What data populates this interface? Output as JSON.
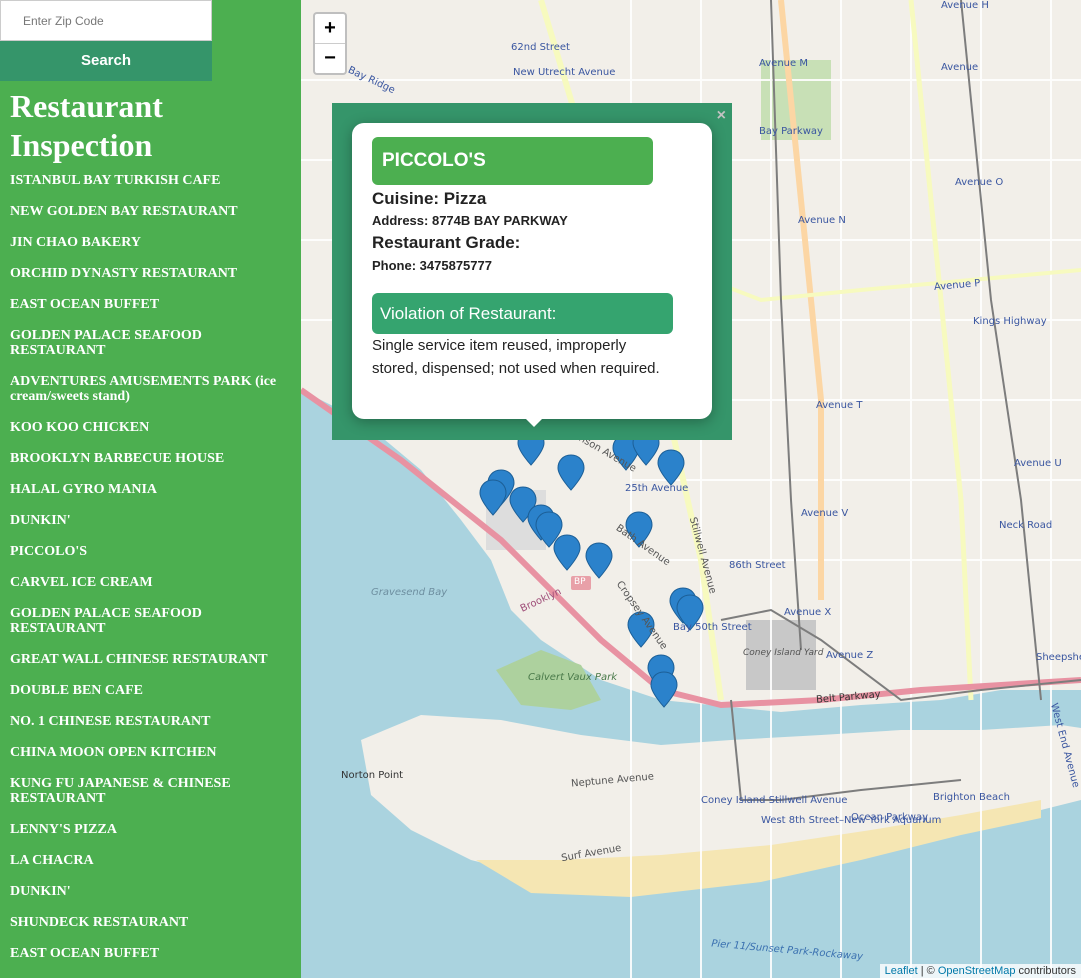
{
  "search": {
    "placeholder": "Enter Zip Code",
    "button_label": "Search"
  },
  "sidebar": {
    "title": "Restaurant Inspection",
    "restaurants": [
      "ISTANBUL BAY TURKISH CAFE",
      "NEW GOLDEN BAY RESTAURANT",
      "JIN CHAO BAKERY",
      "ORCHID DYNASTY RESTAURANT",
      "EAST OCEAN BUFFET",
      "GOLDEN PALACE SEAFOOD RESTAURANT",
      "ADVENTURES AMUSEMENTS PARK (ice cream/sweets stand)",
      "KOO KOO CHICKEN",
      "BROOKLYN BARBECUE HOUSE",
      "HALAL GYRO MANIA",
      "DUNKIN'",
      "PICCOLO'S",
      "CARVEL ICE CREAM",
      "GOLDEN PALACE SEAFOOD RESTAURANT",
      "GREAT WALL CHINESE RESTAURANT",
      "DOUBLE BEN CAFE",
      "NO. 1 CHINESE RESTAURANT",
      "CHINA MOON OPEN KITCHEN",
      "KUNG FU JAPANESE & CHINESE RESTAURANT",
      "LENNY'S PIZZA",
      "LA CHACRA",
      "DUNKIN'",
      "SHUNDECK RESTAURANT",
      "EAST OCEAN BUFFET"
    ]
  },
  "map": {
    "zoom_in": "+",
    "zoom_out": "−",
    "attribution": {
      "leaflet": "Leaflet",
      "separator": " | © ",
      "osm": "OpenStreetMap",
      "suffix": " contributors"
    },
    "labels": [
      "62nd Street",
      "New Utrecht Avenue",
      "Bay Ridge",
      "Avenue H",
      "Avenue",
      "Avenue M",
      "Bay Parkway",
      "Avenue N",
      "Avenue O",
      "Avenue P",
      "Kings Highway",
      "Avenue T",
      "Avenue U",
      "Neck Road",
      "86th Street",
      "25th Avenue",
      "Benson Avenue",
      "Bath Avenue",
      "Stillwell Avenue",
      "Cropsey Avenue",
      "Gravesend Bay",
      "Brooklyn",
      "Bay 50th Street",
      "Coney Island Yard",
      "Belt Parkway",
      "Avenue Z",
      "Sheepshead Bay",
      "Calvert Vaux Park",
      "Neptune Avenue",
      "Norton Point",
      "Coney Island Stillwell Avenue",
      "West 8th Street–New York Aquarium",
      "Ocean Parkway",
      "Brighton Beach",
      "Surf Avenue",
      "West End Avenue",
      "Pier 11/Sunset Park-Rockaway",
      "BP",
      "Avenue X",
      "Avenue V"
    ]
  },
  "popup": {
    "close": "×",
    "name": "PICCOLO'S",
    "cuisine": "Cuisine: Pizza",
    "address": "Address: 8774B BAY PARKWAY",
    "grade": "Restaurant Grade:",
    "phone": "Phone: 3475875777",
    "violation_heading": "Violation of Restaurant:",
    "violation_text": "Single service item reused, improperly stored, dispensed; not used when required."
  },
  "colors": {
    "sidebar": "#4caf50",
    "button": "#35956a",
    "marker": "#2b82cb",
    "water": "#aad3df"
  }
}
